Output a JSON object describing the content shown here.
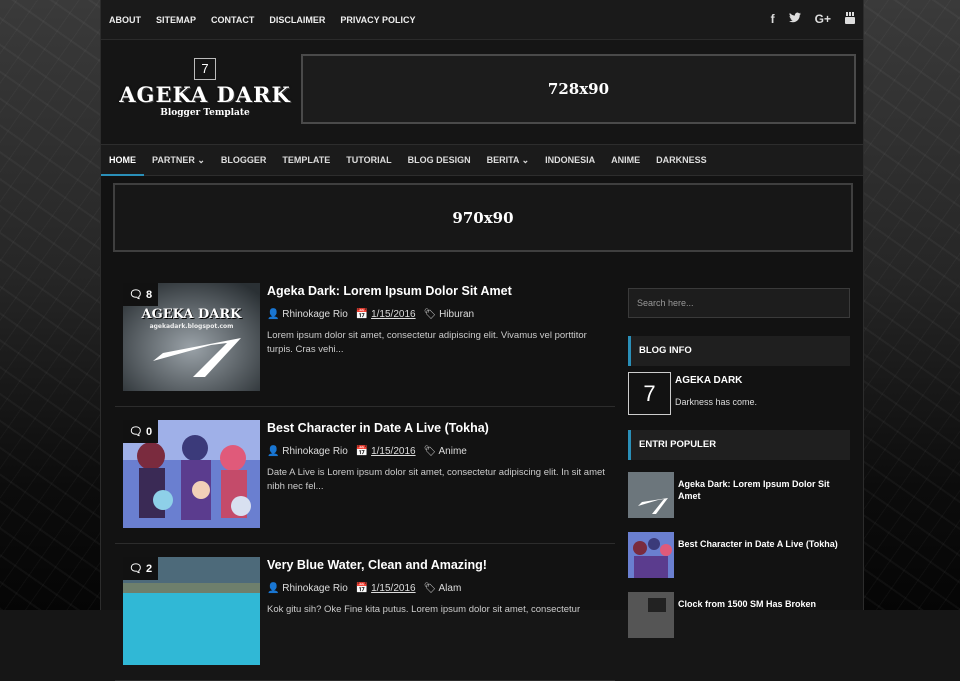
{
  "topnav": [
    "ABOUT",
    "SITEMAP",
    "CONTACT",
    "DISCLAIMER",
    "PRIVACY POLICY"
  ],
  "social": [
    {
      "name": "facebook-icon",
      "glyph": "f"
    },
    {
      "name": "twitter-icon",
      "glyph": "t"
    },
    {
      "name": "google-plus-icon",
      "glyph": "G+"
    },
    {
      "name": "youtube-icon",
      "glyph": "▶"
    }
  ],
  "logo": {
    "title": "AGEKA DARK",
    "sub": "Blogger Template"
  },
  "ad_header": "728x90",
  "menu": [
    {
      "label": "HOME",
      "active": true
    },
    {
      "label": "PARTNER ⌄"
    },
    {
      "label": "BLOGGER"
    },
    {
      "label": "TEMPLATE"
    },
    {
      "label": "TUTORIAL"
    },
    {
      "label": "BLOG DESIGN"
    },
    {
      "label": "BERITA ⌄"
    },
    {
      "label": "INDONESIA"
    },
    {
      "label": "ANIME"
    },
    {
      "label": "DARKNESS"
    }
  ],
  "ad_wide": "970x90",
  "posts": [
    {
      "title": "Ageka Dark: Lorem Ipsum Dolor Sit Amet",
      "comments": "8",
      "author": "Rhinokage Rio",
      "date": "1/15/2016",
      "label": "Hiburan",
      "snippet": "Lorem ipsum dolor sit amet, consectetur adipiscing elit. Vivamus vel porttitor turpis. Cras vehi...",
      "thumb": "logo"
    },
    {
      "title": "Best Character in Date A Live (Tokha)",
      "comments": "0",
      "author": "Rhinokage Rio",
      "date": "1/15/2016",
      "label": "Anime",
      "snippet": "Date A Live is Lorem ipsum dolor sit amet, consectetur adipiscing elit. In sit amet nibh nec fel...",
      "thumb": "anime"
    },
    {
      "title": "Very Blue Water, Clean and Amazing!",
      "comments": "2",
      "author": "Rhinokage Rio",
      "date": "1/15/2016",
      "label": "Alam",
      "snippet": "Kok gitu sih? Oke Fine kita putus. Lorem ipsum dolor sit amet, consectetur",
      "thumb": "water"
    }
  ],
  "thumb_text": {
    "logo_title": "AGEKA DARK",
    "logo_url": "agekadark.blogspot.com"
  },
  "search": {
    "placeholder": "Search here..."
  },
  "widget_info": {
    "title": "BLOG INFO",
    "name": "AGEKA DARK",
    "desc": "Darkness has come."
  },
  "widget_pop": {
    "title": "ENTRI POPULER",
    "items": [
      {
        "title": "Ageka Dark: Lorem Ipsum Dolor Sit Amet",
        "thumb": "logo"
      },
      {
        "title": "Best Character in Date A Live (Tokha)",
        "thumb": "anime"
      },
      {
        "title": "Clock from 1500 SM Has Broken",
        "thumb": "clock"
      }
    ]
  },
  "colors": {
    "accent": "#2a8fb8",
    "bg": "#121212"
  }
}
